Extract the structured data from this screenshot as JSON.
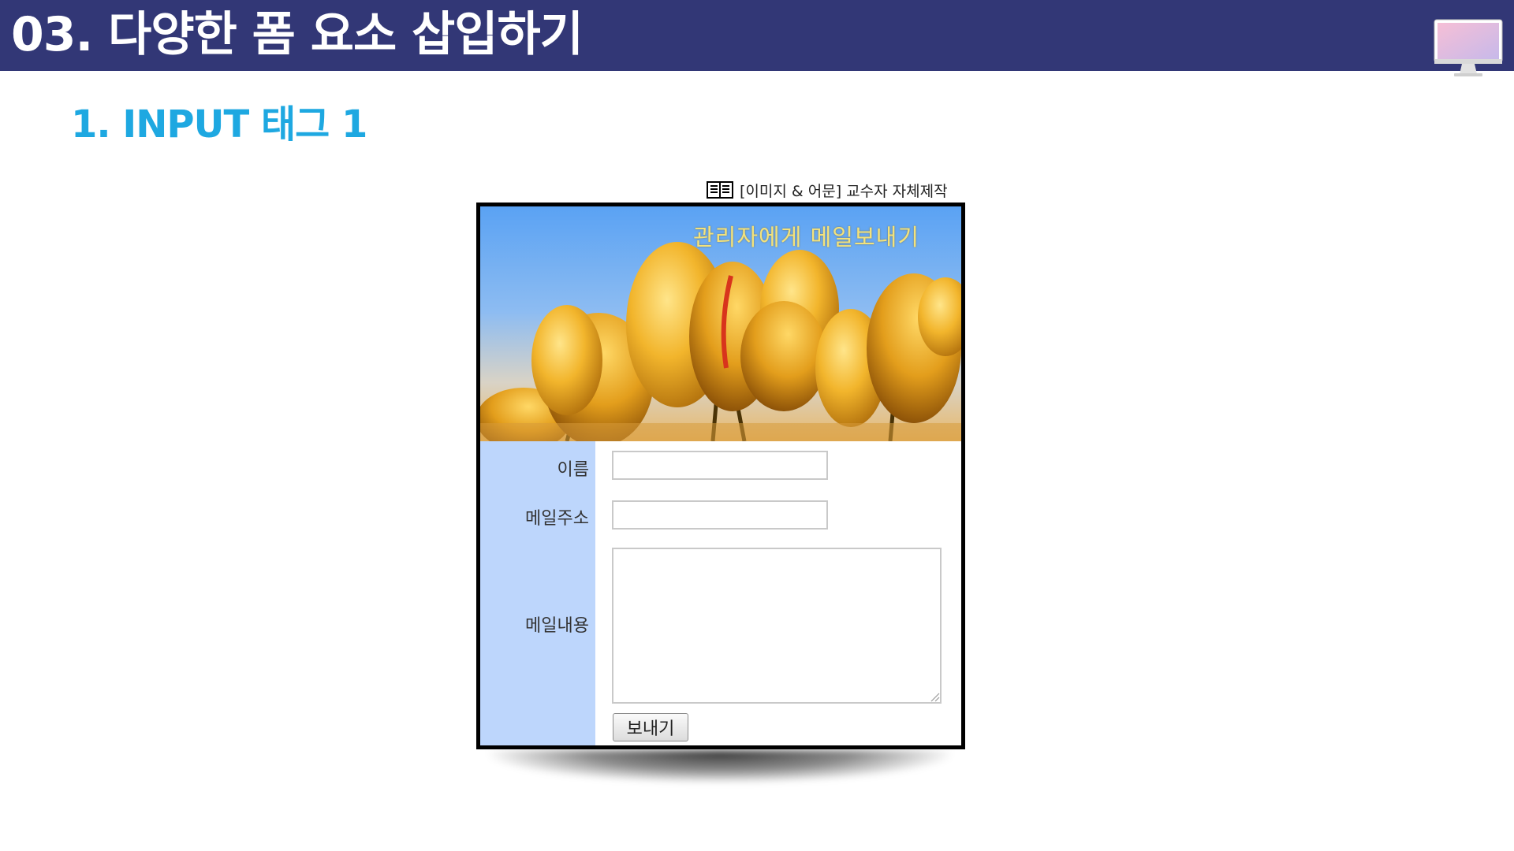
{
  "header": {
    "title": "03. 다양한 폼 요소 삽입하기",
    "icon": "monitor-icon",
    "bg_color": "#323776"
  },
  "section": {
    "subtitle": "1. INPUT 태그 1",
    "color": "#1ea8e1"
  },
  "caption": {
    "icon": "book-icon",
    "text": "[이미지 & 어문] 교수자 자체제작"
  },
  "form_example": {
    "banner_text": "관리자에게 메일보내기",
    "banner_image": "yellow tulips under blue sky",
    "label_column_color": "#bdd6fc",
    "fields": {
      "name_label": "이름",
      "name_value": "",
      "email_label": "메일주소",
      "email_value": "",
      "content_label": "메일내용",
      "content_value": ""
    },
    "submit_label": "보내기"
  }
}
